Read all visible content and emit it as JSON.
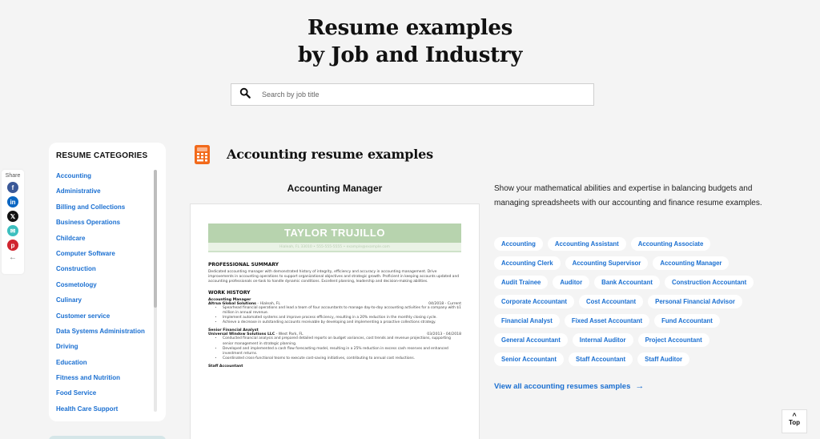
{
  "hero": {
    "title_line1": "Resume examples",
    "title_line2": "by Job and Industry"
  },
  "search": {
    "placeholder": "Search by job title",
    "value": ""
  },
  "share": {
    "label": "Share",
    "icons": [
      "facebook-icon",
      "linkedin-icon",
      "x-icon",
      "email-icon",
      "pinterest-icon",
      "back-arrow-icon"
    ]
  },
  "sidebar": {
    "title": "RESUME CATEGORIES",
    "items": [
      "Accounting",
      "Administrative",
      "Billing and Collections",
      "Business Operations",
      "Childcare",
      "Computer Software",
      "Construction",
      "Cosmetology",
      "Culinary",
      "Customer service",
      "Data Systems Administration",
      "Driving",
      "Education",
      "Fitness and Nutrition",
      "Food Service",
      "Health Care Support"
    ]
  },
  "section": {
    "title": "Accounting resume examples",
    "icon": "calculator-icon",
    "accent": "#f26a1b"
  },
  "resume": {
    "job_title": "Accounting Manager",
    "name": "TAYLOR TRUJILLO",
    "contact": "Hialeah, FL 33010 • 555-555-5555 • example@example.com",
    "summary_heading": "PROFESSIONAL SUMMARY",
    "summary": "Dedicated accounting manager with demonstrated history of integrity, efficiency and accuracy in accounting management. Drive improvements in accounting operations to support organizational objectives and strategic growth. Proficient in keeping accounts updated and accounting professionals on-task to handle dynamic conditions. Excellent planning, leadership and decision-making abilities.",
    "work_heading": "WORK HISTORY",
    "jobs": [
      {
        "title": "Accounting Manager",
        "company": "Altrua Global Solutions",
        "location": " - Hialeah, FL",
        "dates": "04/2018 - Current",
        "bullets": [
          "Spearhead financial operations and lead a team of four accountants to manage day-to-day accounting activities for a company with $1 million in annual revenue.",
          "Implement automated systems and improve process efficiency, resulting in a 20% reduction in the monthly closing cycle.",
          "Achieve a decrease in outstanding accounts receivable by developing and implementing a proactive collections strategy."
        ]
      },
      {
        "title": "Senior Financial Analyst",
        "company": "Universal Window Solutions LLC",
        "location": " - West Park, FL",
        "dates": "03/2013 - 04/2018",
        "bullets": [
          "Conducted financial analysis and prepared detailed reports on budget variances, cost trends and revenue projections, supporting senior management in strategic planning.",
          "Developed and implemented a cash flow forecasting model, resulting in a 25% reduction in excess cash reserves and enhanced investment returns.",
          "Coordinated cross-functional teams to execute cost-saving initiatives, contributing to annual cost reductions."
        ]
      },
      {
        "title": "Staff Accountant"
      }
    ]
  },
  "right": {
    "description": "Show your mathematical abilities and expertise in balancing budgets and managing spreadsheets with our accounting and finance resume examples.",
    "tags": [
      "Accounting",
      "Accounting Assistant",
      "Accounting Associate",
      "Accounting Clerk",
      "Accounting Supervisor",
      "Accounting Manager",
      "Audit Trainee",
      "Auditor",
      "Bank Accountant",
      "Construction Accountant",
      "Corporate Accountant",
      "Cost Accountant",
      "Personal Financial Advisor",
      "Financial Analyst",
      "Fixed Asset Accountant",
      "Fund Accountant",
      "General Accountant",
      "Internal Auditor",
      "Project Accountant",
      "Senior Accountant",
      "Staff Accountant",
      "Staff Auditor"
    ],
    "view_all": "View all accounting resumes samples",
    "view_all_arrow": "→"
  },
  "top_button": {
    "chevron": "^",
    "label": "Top"
  },
  "colors": {
    "link_blue": "#1a6fd1",
    "resume_green": "#b7d3ae",
    "page_bg": "#f4f4f4"
  }
}
